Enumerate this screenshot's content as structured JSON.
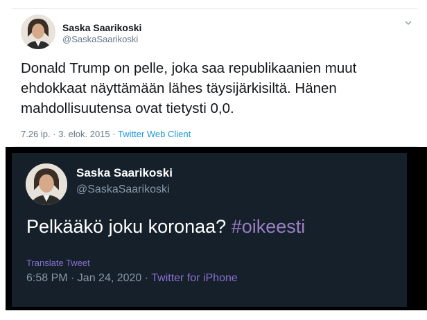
{
  "tweet1": {
    "name": "Saska Saarikoski",
    "handle": "@SaskaSaarikoski",
    "text": "Donald Trump on pelle, joka saa republikaanien muut ehdokkaat näyttämään lähes täysijärkisiltä. Hänen mahdollisuutensa ovat tietysti 0,0.",
    "timestamp": "7.26 ip. · 3. elok. 2015",
    "separator": " · ",
    "source": "Twitter Web Client",
    "menu_icon": "chevron-down-icon"
  },
  "tweet2": {
    "name": "Saska Saarikoski",
    "handle": "@SaskaSaarikoski",
    "text": "Pelkääkö joku koronaa? ",
    "hashtag": "#oikeesti",
    "translate": "Translate Tweet",
    "timestamp": "6:58 PM · Jan 24, 2020",
    "separator": " · ",
    "source": "Twitter for iPhone"
  },
  "colors": {
    "light_bg": "#ffffff",
    "dark_bg": "#15202b",
    "link_light": "#1b95e0",
    "link_dark": "#8a6fd1"
  }
}
